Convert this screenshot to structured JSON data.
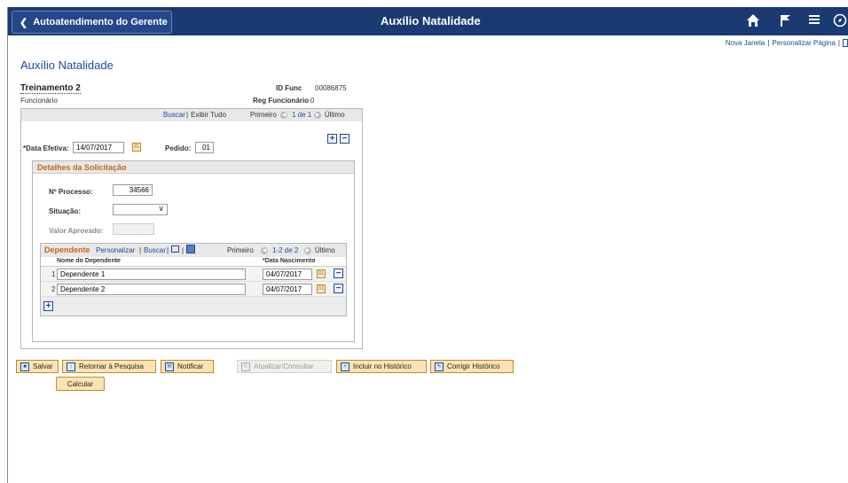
{
  "header": {
    "back_label": "Autoatendimento do Gerente",
    "title": "Auxílio Natalidade"
  },
  "icons": {
    "back": "chevron-left-icon",
    "home": "home-icon",
    "flag": "flag-icon",
    "menu": "hamburger-menu-icon",
    "navbar": "compass-icon"
  },
  "toplinks": {
    "new_window": "Nova Janela",
    "personalize_page": "Personalizar Página"
  },
  "page": {
    "title": "Auxílio Natalidade",
    "employee_name": "Treinamento 2",
    "employee_role": "Funcionário",
    "id_func_label": "ID Func",
    "id_func_value": "00086875",
    "reg_func_label": "Reg Funcionário",
    "reg_func_value": "0"
  },
  "outer_nav": {
    "find": "Buscar",
    "view_all": "Exibir Tudo",
    "first": "Primeiro",
    "range": "1 de 1",
    "last": "Último"
  },
  "form": {
    "effective_date_label": "*Data Efetiva:",
    "effective_date_value": "14/07/2017",
    "order_label": "Pedido:",
    "order_value": "01"
  },
  "details": {
    "title": "Detalhes da Solicitação",
    "process_label": "Nº Processo:",
    "process_value": "34566",
    "status_label": "Situação:",
    "status_value": "",
    "approved_label": "Valor Aprovado:",
    "approved_value": ""
  },
  "dependents": {
    "title": "Dependente",
    "personalize": "Personalizar",
    "find": "Buscar",
    "first": "Primeiro",
    "range": "1-2 de 2",
    "last": "Último",
    "col_name": "Nome do Dependente",
    "col_birth": "*Data Nascimento",
    "rows": [
      {
        "num": "1",
        "name": "Dependente 1",
        "birth": "04/07/2017"
      },
      {
        "num": "2",
        "name": "Dependente 2",
        "birth": "04/07/2017"
      }
    ]
  },
  "calculate_label": "Calcular",
  "toolbar": {
    "save": "Salvar",
    "return": "Retornar à Pesquisa",
    "notify": "Notificar",
    "update": "Atualizar/Consultar",
    "include": "Incluir no Histórico",
    "correct": "Corrigir Histórico"
  },
  "colors": {
    "header_bg": "#1a3a73",
    "link": "#1c4a9b",
    "section_title": "#c06a18",
    "button_bg": "#fde3b4"
  }
}
